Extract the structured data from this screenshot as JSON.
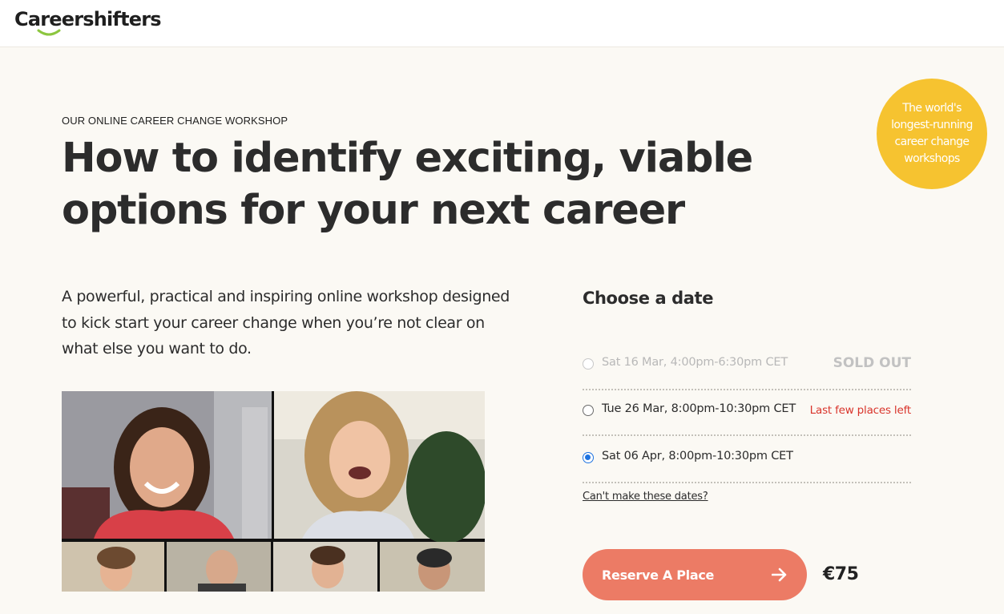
{
  "header": {
    "logo_text": "Careershifters"
  },
  "badge": {
    "text": "The world's longest-running career change workshops",
    "color": "#f6c330"
  },
  "hero": {
    "eyebrow": "OUR ONLINE CAREER CHANGE WORKSHOP",
    "title": "How to identify exciting, viable options for your next career",
    "intro": "A powerful, practical and inspiring online workshop designed to kick start your career change when you’re not clear on what else you want to do."
  },
  "booking": {
    "heading": "Choose a date",
    "dates": [
      {
        "label": "Sat 16 Mar, 4:00pm-6:30pm CET",
        "status": "SOLD OUT",
        "state": "sold-out"
      },
      {
        "label": "Tue 26 Mar, 8:00pm-10:30pm CET",
        "status": "Last few places left",
        "state": "available"
      },
      {
        "label": "Sat 06 Apr, 8:00pm-10:30pm CET",
        "status": "",
        "state": "selected"
      }
    ],
    "cant_make_link": "Can't make these dates?",
    "reserve_label": "Reserve A Place",
    "reserve_icon": "arrow-right-icon",
    "price": "€75",
    "accent_color": "#ec7b65",
    "alert_color": "#d9342b",
    "radio_selected_color": "#1e73e0"
  },
  "video": {
    "participants": 6
  }
}
